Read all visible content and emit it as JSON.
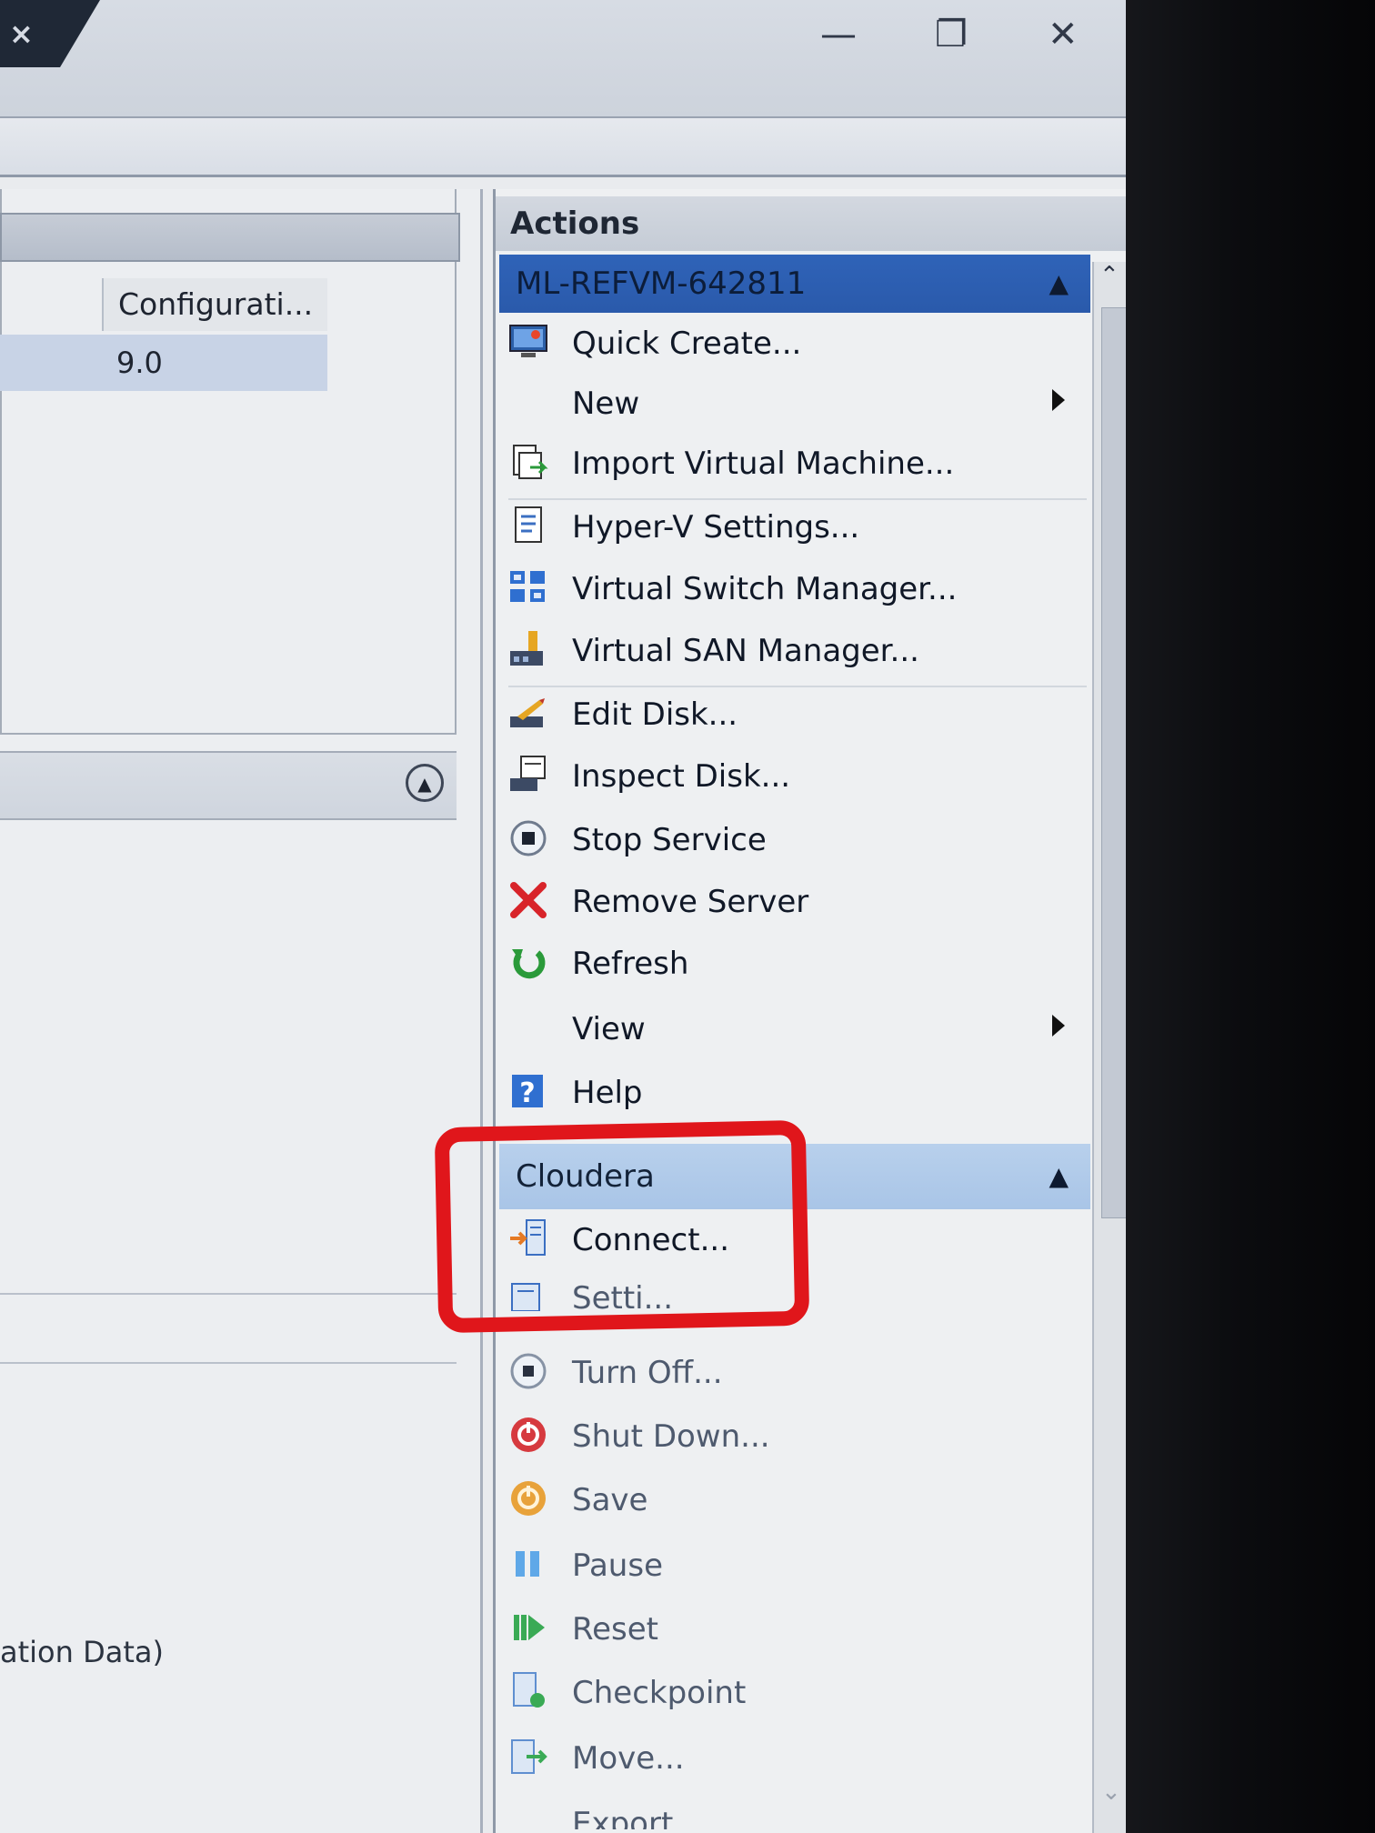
{
  "window": {
    "tab_close_glyph": "×",
    "minimize_glyph": "—",
    "restore_glyph": "❐",
    "close_glyph": "✕"
  },
  "left_pane": {
    "column_header": "Configurati...",
    "row_value": "9.0",
    "partial_text": "ation Data)"
  },
  "actions": {
    "title": "Actions",
    "server_group": {
      "name": "ML-REFVM-642811",
      "items": [
        {
          "label": "Quick Create...",
          "icon": "monitor-icon"
        },
        {
          "label": "New",
          "icon": "",
          "submenu": true
        },
        {
          "label": "Import Virtual Machine...",
          "icon": "import-icon"
        },
        {
          "label": "Hyper-V Settings...",
          "icon": "settings-document-icon"
        },
        {
          "label": "Virtual Switch Manager...",
          "icon": "switch-icon"
        },
        {
          "label": "Virtual SAN Manager...",
          "icon": "san-icon"
        },
        {
          "label": "Edit Disk...",
          "icon": "edit-disk-icon"
        },
        {
          "label": "Inspect Disk...",
          "icon": "inspect-disk-icon"
        },
        {
          "label": "Stop Service",
          "icon": "stop-service-icon"
        },
        {
          "label": "Remove Server",
          "icon": "red-x-icon"
        },
        {
          "label": "Refresh",
          "icon": "refresh-icon"
        },
        {
          "label": "View",
          "icon": "",
          "submenu": true
        },
        {
          "label": "Help",
          "icon": "help-icon"
        }
      ]
    },
    "vm_group": {
      "name": "Cloudera",
      "items": [
        {
          "label": "Connect...",
          "icon": "connect-icon"
        },
        {
          "label": "Setti...",
          "icon": "settings-icon"
        },
        {
          "label": "Turn Off...",
          "icon": "turn-off-icon"
        },
        {
          "label": "Shut Down...",
          "icon": "shut-down-icon"
        },
        {
          "label": "Save",
          "icon": "save-icon"
        },
        {
          "label": "Pause",
          "icon": "pause-icon"
        },
        {
          "label": "Reset",
          "icon": "reset-icon"
        },
        {
          "label": "Checkpoint",
          "icon": "checkpoint-icon"
        },
        {
          "label": "Move...",
          "icon": "move-icon"
        },
        {
          "label": "Export...",
          "icon": "export-icon"
        }
      ]
    },
    "annotation_color": "#e0161b",
    "selected_header_color": "#2f63b8",
    "cloudera_header_color": "#b8d0ec"
  }
}
